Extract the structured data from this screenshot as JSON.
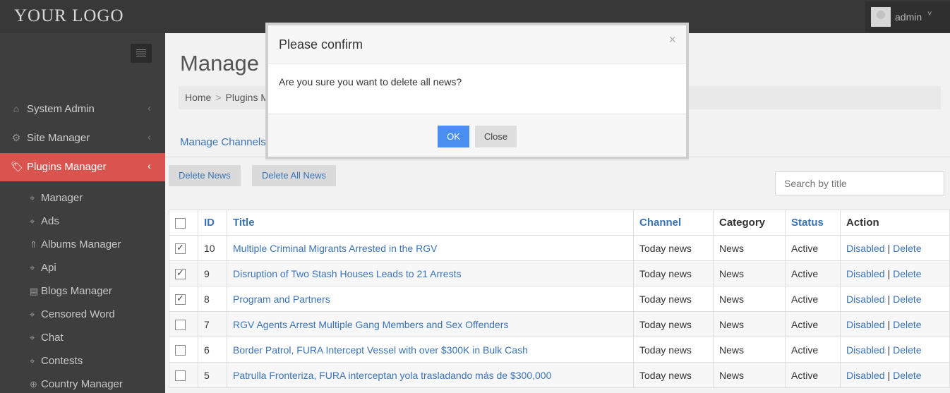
{
  "header": {
    "logo": "YOUR LOGO",
    "username": "admin",
    "caret": "˅"
  },
  "sidebar": {
    "items": [
      {
        "label": "System Admin",
        "icon": "home-icon",
        "glyph": "⌂",
        "chevron": "‹"
      },
      {
        "label": "Site Manager",
        "icon": "cogs-icon",
        "glyph": "⚙",
        "chevron": "‹"
      },
      {
        "label": "Plugins Manager",
        "icon": "tag-icon",
        "glyph": "🏷",
        "chevron": "‹"
      }
    ],
    "subitems": [
      {
        "label": "Manager",
        "icon": "tag-icon",
        "glyph": "⌖"
      },
      {
        "label": "Ads",
        "icon": "tag-icon",
        "glyph": "⌖"
      },
      {
        "label": "Albums Manager",
        "icon": "album-icon",
        "glyph": "⇑"
      },
      {
        "label": "Api",
        "icon": "tag-icon",
        "glyph": "⌖"
      },
      {
        "label": "Blogs Manager",
        "icon": "comment-icon",
        "glyph": "▤"
      },
      {
        "label": "Censored Word",
        "icon": "tag-icon",
        "glyph": "⌖"
      },
      {
        "label": "Chat",
        "icon": "tag-icon",
        "glyph": "⌖"
      },
      {
        "label": "Contests",
        "icon": "tag-icon",
        "glyph": "⌖"
      },
      {
        "label": "Country Manager",
        "icon": "globe-icon",
        "glyph": "⊕"
      }
    ]
  },
  "main": {
    "title": "Manage N",
    "breadcrumb": {
      "home": "Home",
      "sep": ">",
      "plugins": "Plugins M"
    },
    "channel_link": "Manage Channels",
    "buttons": {
      "delete_news": "Delete News",
      "delete_all": "Delete All News"
    },
    "search": {
      "placeholder": "Search by title"
    },
    "table": {
      "headers": [
        "ID",
        "Title",
        "Channel",
        "Category",
        "Status",
        "Action"
      ],
      "action_disabled": "Disabled",
      "action_sep": "|",
      "action_delete": "Delete",
      "rows": [
        {
          "id": "10",
          "title": "Multiple Criminal Migrants Arrested in the RGV",
          "channel": "Today news",
          "category": "News",
          "status": "Active",
          "checked": true
        },
        {
          "id": "9",
          "title": "Disruption of Two Stash Houses Leads to 21 Arrests",
          "channel": "Today news",
          "category": "News",
          "status": "Active",
          "checked": true
        },
        {
          "id": "8",
          "title": "Program and Partners",
          "channel": "Today news",
          "category": "News",
          "status": "Active",
          "checked": true
        },
        {
          "id": "7",
          "title": "RGV Agents Arrest Multiple Gang Members and Sex Offenders",
          "channel": "Today news",
          "category": "News",
          "status": "Active",
          "checked": false
        },
        {
          "id": "6",
          "title": "Border Patrol, FURA Intercept Vessel with over $300K in Bulk Cash",
          "channel": "Today news",
          "category": "News",
          "status": "Active",
          "checked": false
        },
        {
          "id": "5",
          "title": "Patrulla Fronteriza, FURA interceptan yola trasladando más de $300,000",
          "channel": "Today news",
          "category": "News",
          "status": "Active",
          "checked": false
        }
      ]
    }
  },
  "modal": {
    "title": "Please confirm",
    "close_glyph": "×",
    "message": "Are you sure you want to delete all news?",
    "ok": "OK",
    "close": "Close"
  },
  "colors": {
    "accent": "#d9534f",
    "link": "#3a73b6",
    "primary_button": "#4a8ff0"
  }
}
